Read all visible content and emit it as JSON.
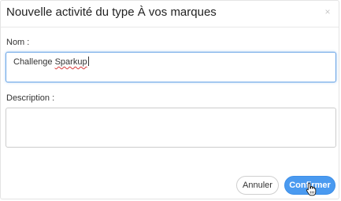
{
  "dialog": {
    "title": "Nouvelle activité du type À vos marques",
    "close_glyph": "×"
  },
  "form": {
    "name": {
      "label": "Nom :",
      "value_prefix": "Challenge ",
      "value_misspelled": "Sparkup"
    },
    "description": {
      "label": "Description :",
      "value": ""
    }
  },
  "buttons": {
    "cancel_label": "Annuler",
    "confirm_label": "Confirmer"
  },
  "colors": {
    "accent": "#4a9af0",
    "focus_border": "#6aa5e6",
    "spellcheck": "#d83a3a"
  },
  "icons": {
    "close": "close-icon",
    "pointer": "hand-pointer-cursor-icon"
  }
}
